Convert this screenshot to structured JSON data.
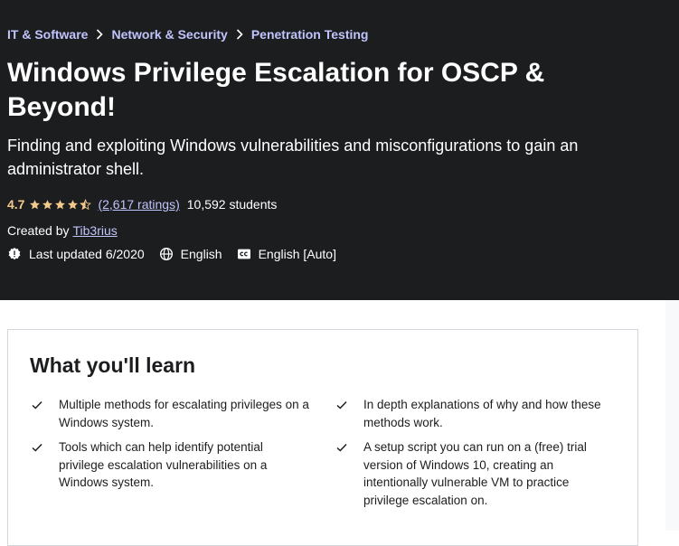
{
  "breadcrumb": [
    "IT & Software",
    "Network & Security",
    "Penetration Testing"
  ],
  "course": {
    "title": "Windows Privilege Escalation for OSCP & Beyond!",
    "subtitle": "Finding and exploiting Windows vulnerabilities and misconfigurations to gain an administrator shell.",
    "rating": "4.7",
    "stars": 4.7,
    "ratings_count": "(2,617 ratings)",
    "students": "10,592 students",
    "created_by_label": "Created by",
    "instructor": "Tib3rius",
    "last_updated": "Last updated 6/2020",
    "language": "English",
    "captions": "English [Auto]"
  },
  "learn": {
    "title": "What you'll learn",
    "items": [
      "Multiple methods for escalating privileges on a Windows system.",
      "In depth explanations of why and how these methods work.",
      "Tools which can help identify potential privilege escalation vulnerabilities on a Windows system.",
      "A setup script you can run on a (free) trial version of Windows 10, creating an intentionally vulnerable VM to practice privilege escalation on."
    ]
  },
  "colors": {
    "header_bg": "#1c1d1f",
    "link": "#c0c4fc",
    "rating": "#f3ca8c",
    "border": "#d1d7dc"
  },
  "icons": {
    "breadcrumb_separator": "chevron-right-icon",
    "star": "star-icon",
    "last_updated": "alert-badge-icon",
    "language": "globe-icon",
    "captions": "closed-captions-icon",
    "learn_check": "check-icon"
  }
}
